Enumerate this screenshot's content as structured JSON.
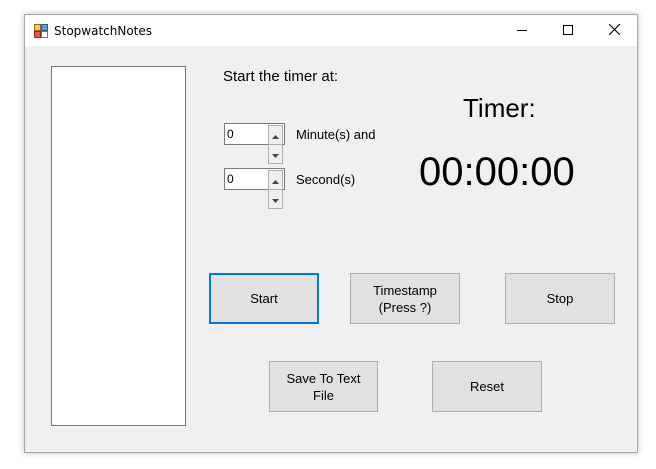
{
  "window": {
    "title": "StopwatchNotes"
  },
  "labels": {
    "start_at": "Start the timer at:",
    "minutes_label": "Minute(s) and",
    "seconds_label": "Second(s)",
    "timer_title": "Timer:",
    "timer_value": "00:00:00"
  },
  "inputs": {
    "minutes_value": "0",
    "seconds_value": "0"
  },
  "buttons": {
    "start": "Start",
    "timestamp": "Timestamp\n(Press ?)",
    "stop": "Stop",
    "save": "Save To Text\nFile",
    "reset": "Reset"
  },
  "colors": {
    "window_bg": "#f0f0f0",
    "button_bg": "#e1e1e1",
    "focus_border": "#0078d7"
  },
  "icons": {
    "app": "app-icon",
    "minimize": "minimize-icon",
    "maximize": "maximize-icon",
    "close": "close-icon"
  }
}
